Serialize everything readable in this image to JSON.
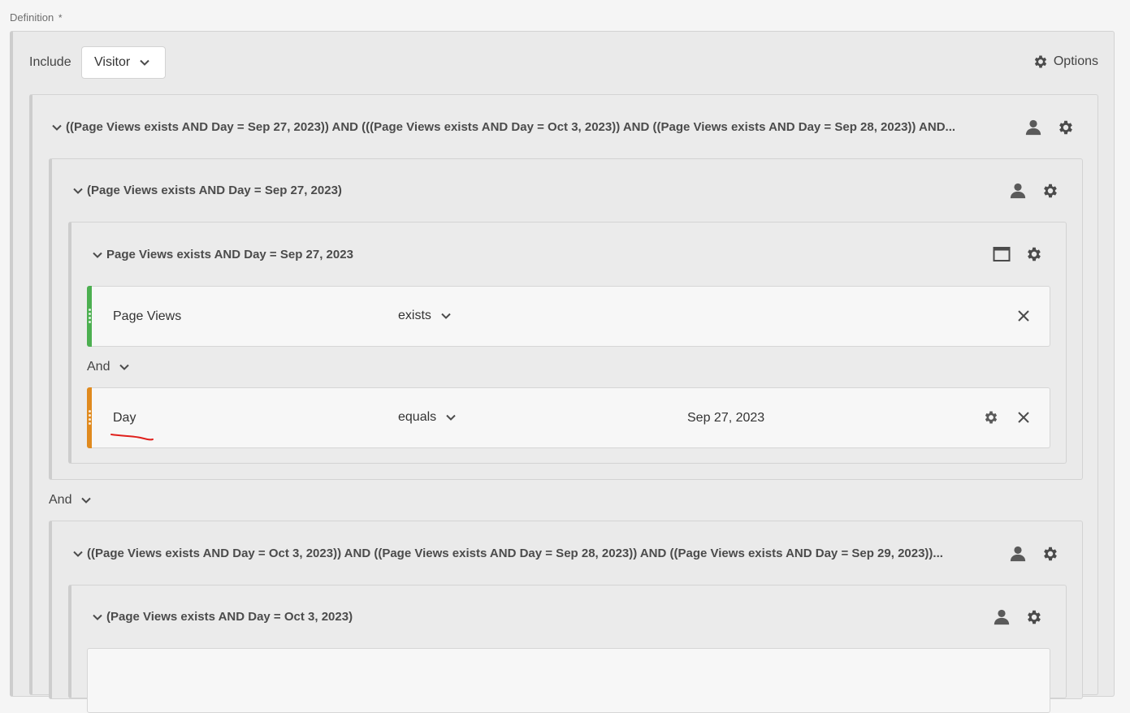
{
  "definition": {
    "label": "Definition",
    "required_mark": "*"
  },
  "header": {
    "include_label": "Include",
    "scope_select": "Visitor",
    "options_label": "Options"
  },
  "containers": {
    "top": {
      "title": "((Page Views exists AND Day = Sep 27, 2023)) AND (((Page Views exists AND Day = Oct 3, 2023)) AND ((Page Views exists AND Day = Sep 28, 2023)) AND..."
    },
    "group1": {
      "title": "(Page Views exists AND Day = Sep 27, 2023)"
    },
    "group1_inner": {
      "title": "Page Views exists AND Day = Sep 27, 2023"
    },
    "group2": {
      "title": "((Page Views exists AND Day = Oct 3, 2023)) AND ((Page Views exists AND Day = Sep 28, 2023)) AND ((Page Views exists AND Day = Sep 29, 2023))..."
    },
    "group2_inner": {
      "title": "(Page Views exists AND Day = Oct 3, 2023)"
    }
  },
  "rules": [
    {
      "dimension": "Page Views",
      "operator": "exists",
      "value": "",
      "color": "#4caf50"
    },
    {
      "dimension": "Day",
      "operator": "equals",
      "value": "Sep 27, 2023",
      "color": "#e08a1e"
    }
  ],
  "connectors": {
    "inner_and": "And",
    "outer_and": "And"
  },
  "icons": {
    "chevron": "chevron-down-icon",
    "person": "person-icon",
    "gear": "gear-icon",
    "window": "window-icon",
    "close": "close-icon"
  },
  "colors": {
    "annotation_underline": "#e0201c"
  }
}
